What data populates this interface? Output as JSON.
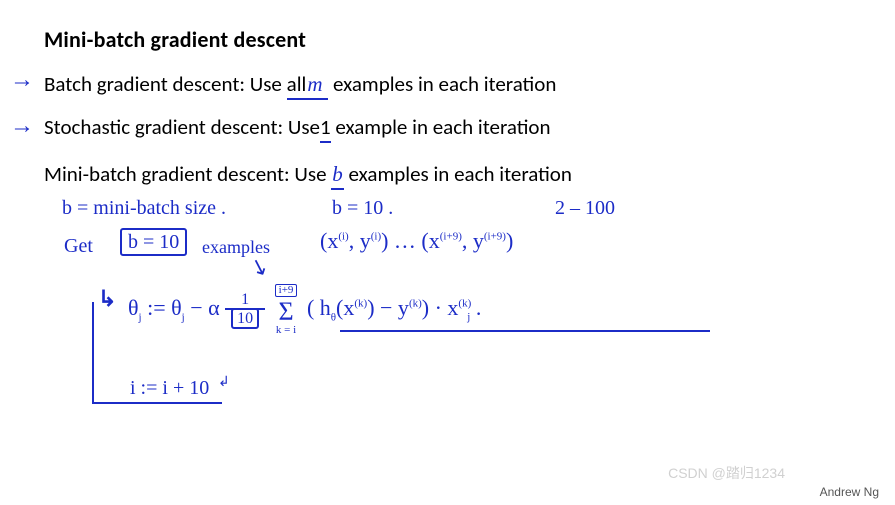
{
  "title": "Mini-batch gradient descent",
  "bullets": {
    "batch": {
      "prefix": "Batch gradient descent: Use ",
      "underlined": "all",
      "var": "m",
      "suffix": " examples in each iteration"
    },
    "sgd": {
      "prefix": "Stochastic gradient descent: Use",
      "underlined": " 1",
      "suffix": " example in each iteration"
    },
    "mini": {
      "prefix": "Mini-batch gradient descent: Use ",
      "var": "b",
      "suffix": " examples in each iteration"
    }
  },
  "handwritten": {
    "b_def": "b = mini-batch size .",
    "b_val": "b = 10 .",
    "b_range": "2 – 100",
    "get": "Get",
    "b_box": "b = 10",
    "examples": "examples",
    "ex_list_open": "(x",
    "ex_list_i": "(i)",
    "ex_list_y": ", y",
    "ex_list_yi": "(i)",
    "ex_list_dots": ") … (x",
    "ex_list_i9": "(i+9)",
    "ex_list_y2": ", y",
    "ex_list_yi9": "(i+9)",
    "ex_list_close": ")",
    "theta_lhs": "θ",
    "theta_j": "j",
    "assign": " := θ",
    "theta_j2": "j",
    "minus": " − α ",
    "frac_num": "1",
    "frac_den": "10",
    "sigma_top": "i+9",
    "sigma_sym": "Σ",
    "sigma_bot": "k = i",
    "term_open": "( h",
    "term_o": "θ",
    "term_xk": "(x",
    "term_xk_sup": "(k)",
    "term_mid": ") − y",
    "term_yk_sup": "(k)",
    "term_close": ") · x",
    "term_xj_sup": "(k)",
    "term_xj_sub": "j",
    "term_dot": " .",
    "i_update": "i := i + 10"
  },
  "footer": {
    "watermark": "CSDN @踏归1234",
    "author": "Andrew Ng"
  }
}
